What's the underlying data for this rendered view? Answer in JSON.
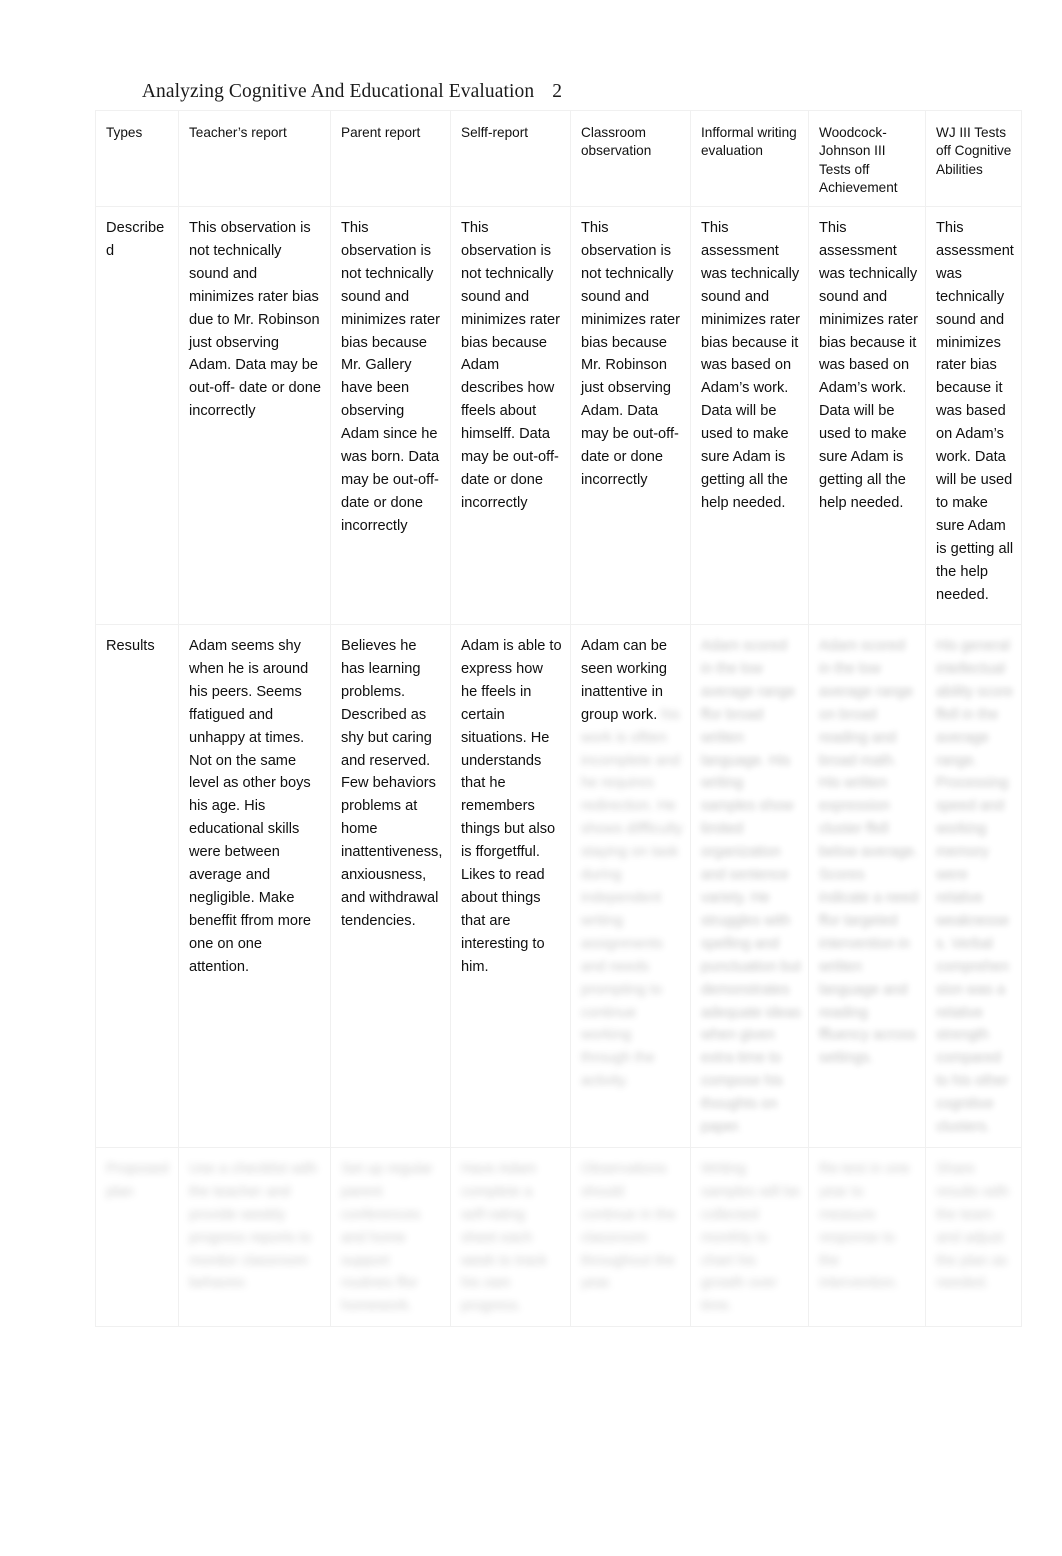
{
  "header": {
    "running_head": "Analyzing Cognitive And Educational Evaluation",
    "page_number": "2"
  },
  "table": {
    "columns": [
      "Types",
      "Teacher’s report",
      "Parent report",
      "Selff-report",
      "Classroom observation",
      "Infformal writing evaluation",
      "Woodcock-Johnson III Tests off Achievement",
      "WJ III Tests off Cognitive Abilities"
    ],
    "rows": [
      {
        "label": "Described",
        "label_style": "large",
        "cells": [
          {
            "text": "This observation is not technically sound and minimizes rater bias due to Mr. Robinson just observing Adam. Data may be out-off- date or done incorrectly",
            "legible": true
          },
          {
            "text": "This observation is not technically sound and minimizes rater bias because Mr. Gallery have been observing Adam since he was born. Data may be out-off- date or done incorrectly",
            "legible": true
          },
          {
            "text": "This observation is not technically sound and minimizes rater bias because Adam describes how ffeels about himselff. Data may be out-off- date or done incorrectly",
            "legible": true
          },
          {
            "text": "This observation is not technically sound and minimizes rater bias because Mr. Robinson just observing Adam. Data may be out-off- date or done incorrectly",
            "legible": true
          },
          {
            "text": "This assessment was technically sound and minimizes rater bias because it was based on Adam’s work. Data will be used to make sure Adam is getting all the help needed.",
            "legible": true
          },
          {
            "text": "This assessment was technically sound and minimizes rater bias because it was based on Adam’s work. Data will be used to make sure Adam is getting all the help needed.",
            "legible": true
          },
          {
            "text": "This assessment was technically sound and minimizes rater bias because it was based on Adam’s work. Data will be used to make sure Adam is getting all the help needed.",
            "legible": true
          }
        ]
      },
      {
        "label": "Results",
        "label_style": "small",
        "cells": [
          {
            "text": "Adam seems shy when he is around his peers. Seems ffatigued and unhappy at times. Not on the same level as other boys his age. His educational skills were between average and negligible. Make beneffit ffrom more one on one attention.",
            "legible": true
          },
          {
            "text": "Believes he has learning problems. Described as shy but caring and reserved. Few behaviors problems at home inattentiveness, anxiousness, and withdrawal tendencies.",
            "legible": true
          },
          {
            "text": "Adam is able to express how he ffeels in certain situations. He understands that he remembers things but also is fforgetfful. Likes to read about things that are interesting to him.",
            "legible": true
          },
          {
            "text": "Adam can be seen working inattentive in group work.",
            "legible": true,
            "blurred_tail": "his work is oftten incomplete and he requires redirection. He shows diffficulty staying on task during independent writing assignments and needs prompting to continue working through the activity."
          },
          {
            "text": "",
            "legible": false,
            "blurred_tail": "Adam scored in the low average range ffor broad written language. His writing samples show limited organization and sentence variety. He struggles with spelling and punctuation but demonstrates adequate ideas when given extra time to compose his thoughts on paper."
          },
          {
            "text": "",
            "legible": false,
            "blurred_tail": "Adam scored in the low average range on broad reading and broad math. His written expression cluster ffell below average. Scores indicate a need ffor targeted intervention in written language and reading ffluency across settings."
          },
          {
            "text": "",
            "legible": false,
            "blurred_tail": "His general intellectual ability score ffell in the average range. Processing speed and working memory were relative weaknesses. Verbal comprehension was a relative strength compared to his other cognitive clusters."
          }
        ]
      },
      {
        "label": "",
        "label_style": "small",
        "label_blurred": "Proposed plan",
        "cells": [
          {
            "text": "",
            "legible": false,
            "blurred_tail": "Use a checklist with the teacher and provide weekly progress reports to monitor classroom behavior."
          },
          {
            "text": "",
            "legible": false,
            "blurred_tail": "Set up regular parent conferences and home support routines ffor homework."
          },
          {
            "text": "",
            "legible": false,
            "blurred_tail": "Have Adam complete a self-rating sheet each week to track his own progress."
          },
          {
            "text": "",
            "legible": false,
            "blurred_tail": "Observations should continue in the classroom throughout the year."
          },
          {
            "text": "",
            "legible": false,
            "blurred_tail": "Writing samples will be collected monthly to chart his growth over time."
          },
          {
            "text": "",
            "legible": false,
            "blurred_tail": "Re-test in one year to measure response to the intervention."
          },
          {
            "text": "",
            "legible": false,
            "blurred_tail": "Share results with the team and adjust the plan as needed."
          }
        ]
      }
    ]
  }
}
